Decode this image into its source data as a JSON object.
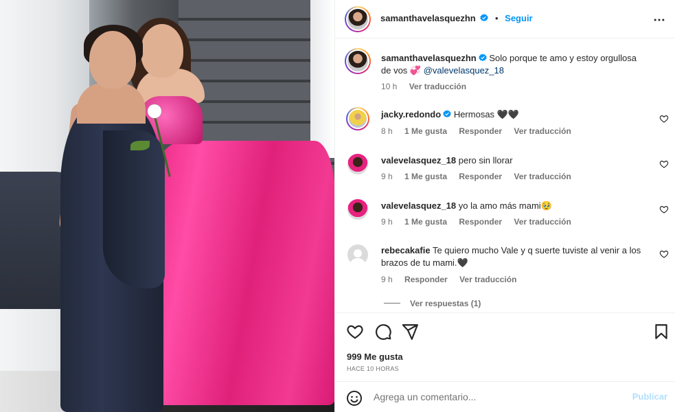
{
  "post": {
    "author": "samanthavelasquezhn",
    "follow_label": "Seguir",
    "separator": "•",
    "caption_text": "Solo porque te amo y estoy orgullosa de vos 💞 ",
    "caption_mention": "@valevelasquez_18",
    "caption_time": "10 h",
    "caption_translate": "Ver traducción"
  },
  "comments": [
    {
      "user": "jacky.redondo",
      "verified": true,
      "text": "Hermosas 🖤🖤",
      "time": "8 h",
      "likes": "1 Me gusta",
      "reply": "Responder",
      "translate": "Ver traducción"
    },
    {
      "user": "valevelasquez_18",
      "verified": false,
      "text": "pero sin llorar",
      "time": "9 h",
      "likes": "1 Me gusta",
      "reply": "Responder",
      "translate": "Ver traducción"
    },
    {
      "user": "valevelasquez_18",
      "verified": false,
      "text": "yo la amo más mami🥹",
      "time": "9 h",
      "likes": "1 Me gusta",
      "reply": "Responder",
      "translate": "Ver traducción"
    },
    {
      "user": "rebecakafie",
      "verified": false,
      "text": "Te quiero mucho Vale y q suerte tuviste al venir a los brazos de tu mami.🖤",
      "time": "9 h",
      "reply": "Responder",
      "translate": "Ver traducción"
    }
  ],
  "view_replies": "Ver respuestas (1)",
  "actions": {
    "like_icon": "heart-icon",
    "comment_icon": "comment-icon",
    "share_icon": "share-icon",
    "save_icon": "bookmark-icon"
  },
  "likes_count": "999 Me gusta",
  "time_ago": "HACE 10 HORAS",
  "composer": {
    "placeholder": "Agrega un comentario...",
    "post_label": "Publicar",
    "emoji_icon": "emoji-icon"
  },
  "colors": {
    "link_blue": "#0095f6",
    "mention": "#00376b",
    "muted": "#737373",
    "post_disabled": "#b2dffc"
  }
}
